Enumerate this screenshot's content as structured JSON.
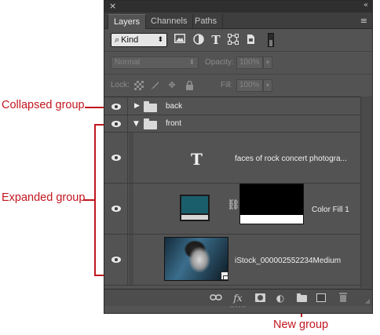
{
  "panel": {
    "close_glyph": "×",
    "collapse_glyph": "«",
    "tabs": [
      {
        "label": "Layers",
        "active": true
      },
      {
        "label": "Channels",
        "active": false
      },
      {
        "label": "Paths",
        "active": false
      }
    ],
    "menu_glyph": "≡"
  },
  "filter": {
    "kind_label": "Kind",
    "icons": [
      "image-filter-icon",
      "adjustment-filter-icon",
      "type-filter-icon",
      "shape-filter-icon",
      "smart-object-filter-icon"
    ],
    "type_glyph": "T"
  },
  "blend": {
    "mode": "Normal",
    "opacity_label": "Opacity:",
    "opacity_value": "100%",
    "fill_label": "Fill:",
    "fill_value": "100%"
  },
  "lock": {
    "label": "Lock:"
  },
  "layers": [
    {
      "name": "back",
      "kind": "group",
      "expanded": false
    },
    {
      "name": "front",
      "kind": "group",
      "expanded": true
    },
    {
      "name": "faces of rock concert photogra...",
      "kind": "type",
      "glyph": "T"
    },
    {
      "name": "Color Fill 1",
      "kind": "fill",
      "swatch_color": "#1b5e6b"
    },
    {
      "name": "iStock_000002552234Medium",
      "kind": "smart-object"
    }
  ],
  "footer": {
    "link_glyph": "⊖",
    "fx_label": "fx",
    "adjust_glyph": "◐"
  },
  "callouts": {
    "collapsed": "Collapsed group",
    "expanded": "Expanded group",
    "new_group": "New group"
  },
  "colors": {
    "callout_red": "#c2161f",
    "panel_bg": "#535353"
  }
}
